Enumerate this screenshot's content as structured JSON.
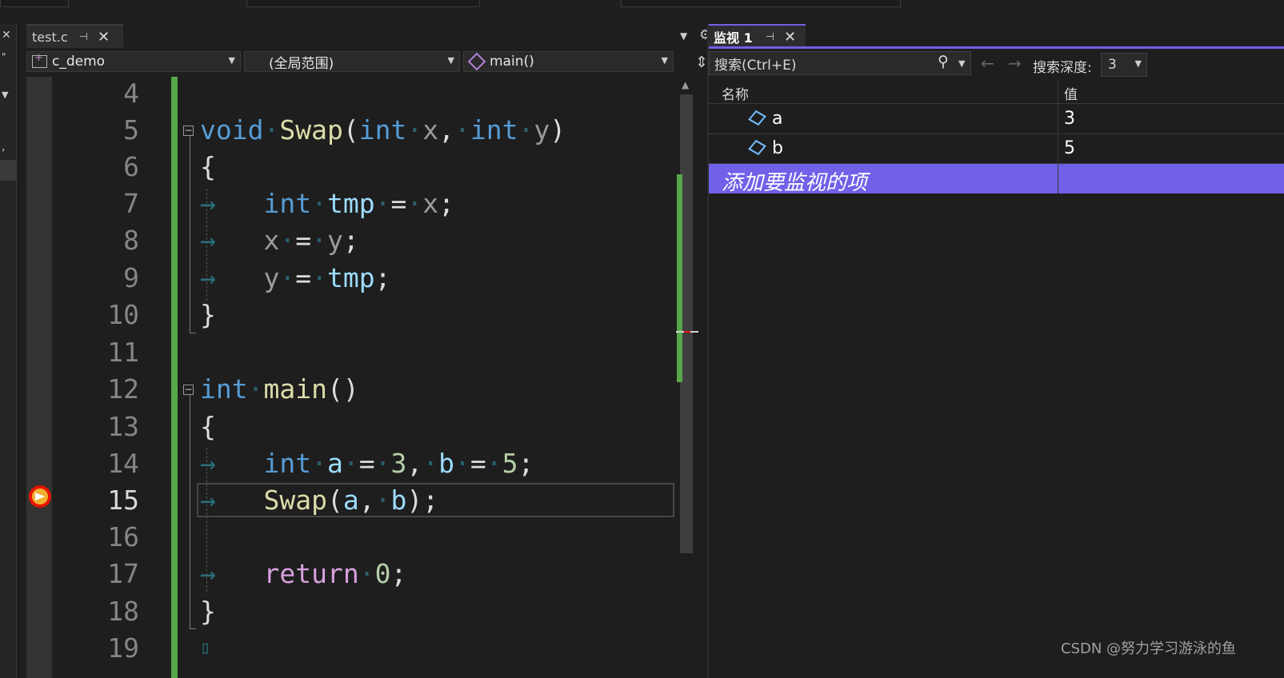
{
  "editor": {
    "tab_label": "test.c",
    "pin_glyph": "⊣",
    "close_glyph": "✕",
    "project_combo": "c_demo",
    "scope_combo": "(全局范围)",
    "function_combo": "main()",
    "line_numbers": [
      "4",
      "5",
      "6",
      "7",
      "8",
      "9",
      "10",
      "11",
      "12",
      "13",
      "14",
      "15",
      "16",
      "17",
      "18",
      "19"
    ],
    "current_line": "15"
  },
  "code": {
    "l5": {
      "kw1": "void",
      "fn": "Swap",
      "p1": "(",
      "kw2": "int",
      "a1": "x",
      "c1": ",",
      "kw3": "int",
      "a2": "y",
      "p2": ")"
    },
    "l6": {
      "brace": "{"
    },
    "l7": {
      "kw": "int",
      "var": "tmp",
      "op": "=",
      "rhs": "x",
      "semi": ";"
    },
    "l8": {
      "lhs": "x",
      "op": "=",
      "rhs": "y",
      "semi": ";"
    },
    "l9": {
      "lhs": "y",
      "op": "=",
      "rhs": "tmp",
      "semi": ";"
    },
    "l10": {
      "brace": "}"
    },
    "l12": {
      "kw": "int",
      "fn": "main",
      "parens": "()"
    },
    "l13": {
      "brace": "{"
    },
    "l14": {
      "kw": "int",
      "v1": "a",
      "op1": "=",
      "n1": "3",
      "comma": ",",
      "v2": "b",
      "op2": "=",
      "n2": "5",
      "semi": ";"
    },
    "l15": {
      "fn": "Swap",
      "p1": "(",
      "a1": "a",
      "comma": ",",
      "a2": "b",
      "p2": ")",
      "semi": ";"
    },
    "l17": {
      "kw": "return",
      "num": "0",
      "semi": ";"
    },
    "l18": {
      "brace": "}"
    }
  },
  "watch": {
    "tab_label": "监视 1",
    "search_placeholder": "搜索(Ctrl+E)",
    "depth_label": "搜索深度:",
    "depth_value": "3",
    "col_name": "名称",
    "col_value": "值",
    "rows": [
      {
        "name": "a",
        "value": "3"
      },
      {
        "name": "b",
        "value": "5"
      }
    ],
    "add_item": "添加要监视的项"
  },
  "colors": {
    "accent": "#7160e8",
    "keyword": "#569cd6",
    "function": "#dcdcaa",
    "change_bar": "#57a64a"
  },
  "watermark": "CSDN @努力学习游泳的鱼"
}
